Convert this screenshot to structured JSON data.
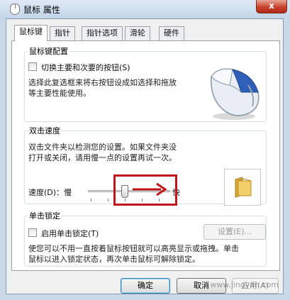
{
  "window": {
    "title": "鼠标 属性",
    "close_glyph": "x"
  },
  "tabs": [
    {
      "label": "鼠标键",
      "active": true
    },
    {
      "label": "指针"
    },
    {
      "label": "指针选项"
    },
    {
      "label": "滑轮"
    },
    {
      "label": "硬件"
    }
  ],
  "button_config": {
    "legend": "鼠标键配置",
    "swap_label": "切换主要和次要的按钮(S)",
    "desc_line1": "选择此复选框来将右按钮设成如选择和拖放",
    "desc_line2": "等主要性能使用。"
  },
  "double_click": {
    "legend": "双击速度",
    "desc_line1": "双击文件夹以检测您的设置。如果文件夹没",
    "desc_line2": "打开或关闭，请用慢一点的设置再试一次。",
    "speed_label": "速度(D)：慢",
    "fast_label": "快",
    "speed_level": 0.45
  },
  "click_lock": {
    "legend": "单击锁定",
    "enable_label": "启用单击锁定(T)",
    "settings_button": "设置(E)...",
    "desc_line1": "使您可以不用一直按着鼠标按钮就可以高亮显示或拖拽。单击",
    "desc_line2": "鼠标以进入锁定状态，再次单击鼠标可解除锁定。"
  },
  "footer": {
    "ok": "确定",
    "cancel": "取消",
    "apply": "应用(A)"
  },
  "watermark": "www.jingyan.com",
  "colors": {
    "annotation_red": "#c0161b",
    "title_bar": "#c9d9ea",
    "close_button": "#c8422c"
  }
}
